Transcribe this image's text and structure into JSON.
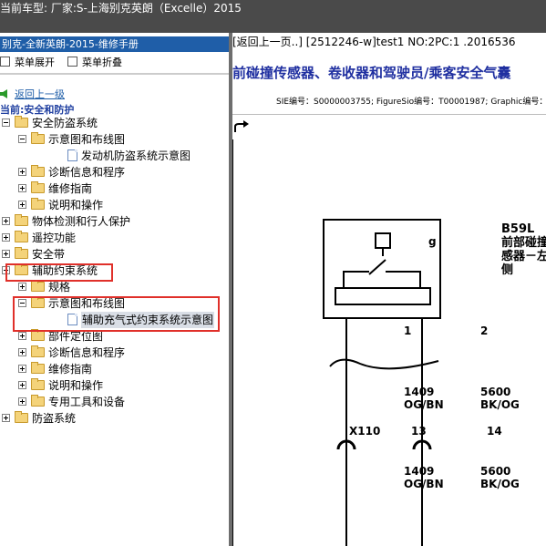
{
  "window": {
    "vehicle_bar": "当前车型:  厂家:S-上海别克英朗（Excelle）2015"
  },
  "left_panel": {
    "title": "别克-全新英朗-2015-维修手册",
    "toolbar": {
      "expand_label": "菜单展开",
      "collapse_label": "菜单折叠"
    },
    "back_link": "返回上一级",
    "current_label": "当前:安全和防护",
    "tree": [
      {
        "label": "安全防盗系统",
        "level": 0,
        "state": "expanded",
        "icon": "folder-icon"
      },
      {
        "label": "示意图和布线图",
        "level": 1,
        "state": "expanded",
        "icon": "folder-icon"
      },
      {
        "label": "发动机防盗系统示意图",
        "level": 2,
        "state": "leaf",
        "icon": "document-icon"
      },
      {
        "label": "诊断信息和程序",
        "level": 1,
        "state": "collapsed",
        "icon": "folder-icon"
      },
      {
        "label": "维修指南",
        "level": 1,
        "state": "collapsed",
        "icon": "folder-icon"
      },
      {
        "label": "说明和操作",
        "level": 1,
        "state": "collapsed",
        "icon": "folder-icon"
      },
      {
        "label": "物体检测和行人保护",
        "level": 0,
        "state": "collapsed",
        "icon": "folder-icon"
      },
      {
        "label": "遥控功能",
        "level": 0,
        "state": "collapsed",
        "icon": "folder-icon"
      },
      {
        "label": "安全带",
        "level": 0,
        "state": "collapsed",
        "icon": "folder-icon"
      },
      {
        "label": "辅助约束系统",
        "level": 0,
        "state": "expanded",
        "icon": "folder-icon"
      },
      {
        "label": "规格",
        "level": 1,
        "state": "collapsed",
        "icon": "folder-icon"
      },
      {
        "label": "示意图和布线图",
        "level": 1,
        "state": "expanded",
        "icon": "folder-icon"
      },
      {
        "label": "辅助充气式约束系统示意图",
        "level": 2,
        "state": "leaf",
        "icon": "document-icon",
        "selected": true
      },
      {
        "label": "部件定位图",
        "level": 1,
        "state": "collapsed",
        "icon": "folder-icon"
      },
      {
        "label": "诊断信息和程序",
        "level": 1,
        "state": "collapsed",
        "icon": "folder-icon"
      },
      {
        "label": "维修指南",
        "level": 1,
        "state": "collapsed",
        "icon": "folder-icon"
      },
      {
        "label": "说明和操作",
        "level": 1,
        "state": "collapsed",
        "icon": "folder-icon"
      },
      {
        "label": "专用工具和设备",
        "level": 1,
        "state": "collapsed",
        "icon": "folder-icon"
      },
      {
        "label": "防盗系统",
        "level": 0,
        "state": "collapsed",
        "icon": "folder-icon"
      }
    ]
  },
  "right_panel": {
    "nav": "[返回上一页..] [2512246-w]test1 NO:2PC:1 .2016536",
    "doc_title": "前碰撞传感器、卷收器和驾驶员/乘客安全气囊",
    "meta": "SIE编号：S0000003755;  FigureSio编号：T00001987;  Graphic编号：3",
    "diagram": {
      "component_id": "B59L",
      "component_name_1": "前部碰撞",
      "component_name_2": "感器－左",
      "component_name_3": "侧",
      "box_letter": "g",
      "pin_1": "1",
      "pin_2": "2",
      "wire_a_circuit": "1409",
      "wire_a_color": "OG/BN",
      "wire_b_circuit": "5600",
      "wire_b_color": "BK/OG",
      "connector_label": "X110",
      "connector_pin_a": "13",
      "connector_pin_b": "14",
      "wire_c_circuit": "1409",
      "wire_c_color": "OG/BN",
      "wire_d_circuit": "5600",
      "wire_d_color": "BK/OG"
    }
  },
  "colors": {
    "title_bar": "#1f5ea8",
    "top_bar": "#4a4a4a",
    "highlight_box": "#e0302a",
    "doc_title": "#1f2fa0"
  }
}
